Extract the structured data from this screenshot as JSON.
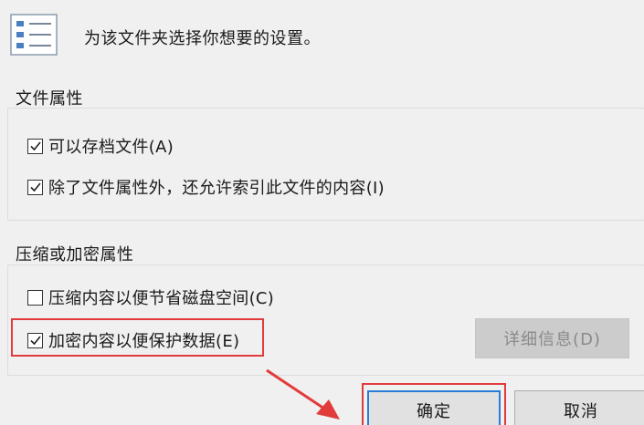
{
  "window": {
    "header_text": "为该文件夹选择你想要的设置。",
    "header_icon": "settings-list-icon"
  },
  "file_attributes": {
    "title": "文件属性",
    "options": [
      {
        "label": "可以存档文件(A)",
        "checked": true
      },
      {
        "label": "除了文件属性外，还允许索引此文件的内容(I)",
        "checked": true
      }
    ]
  },
  "compress_encrypt": {
    "title": "压缩或加密属性",
    "options": [
      {
        "label": "压缩内容以便节省磁盘空间(C)",
        "checked": false
      },
      {
        "label": "加密内容以便保护数据(E)",
        "checked": true
      }
    ],
    "details_label": "详细信息(D)"
  },
  "buttons": {
    "ok_label": "确定",
    "cancel_label": "取消"
  },
  "colors": {
    "annotation_red": "#e23b3b",
    "focus_blue": "#2b7bd6",
    "dialog_bg": "#f0f0f0"
  }
}
